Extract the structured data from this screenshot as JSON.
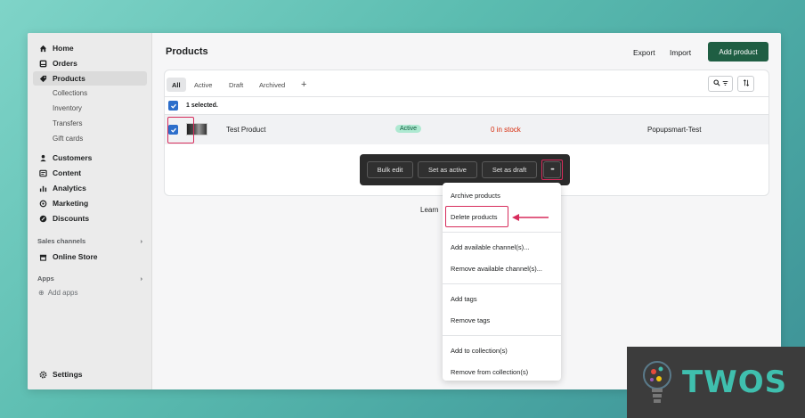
{
  "sidebar": {
    "items": [
      {
        "label": "Home",
        "icon": "home-icon"
      },
      {
        "label": "Orders",
        "icon": "orders-icon"
      },
      {
        "label": "Products",
        "icon": "tag-icon"
      }
    ],
    "sub_items": [
      "Collections",
      "Inventory",
      "Transfers",
      "Gift cards"
    ],
    "items2": [
      {
        "label": "Customers",
        "icon": "person-icon"
      },
      {
        "label": "Content",
        "icon": "content-icon"
      },
      {
        "label": "Analytics",
        "icon": "bar-chart-icon"
      },
      {
        "label": "Marketing",
        "icon": "target-icon"
      },
      {
        "label": "Discounts",
        "icon": "discount-icon"
      }
    ],
    "sales_channels": "Sales channels",
    "online_store": "Online Store",
    "apps": "Apps",
    "add_apps": "Add apps",
    "settings": "Settings"
  },
  "header": {
    "title": "Products",
    "export": "Export",
    "import": "Import",
    "add_product": "Add product"
  },
  "tabs": [
    "All",
    "Active",
    "Draft",
    "Archived",
    "+"
  ],
  "selection": {
    "label": "1 selected."
  },
  "product": {
    "name": "Test Product",
    "status": "Active",
    "inventory": "0 in stock",
    "vendor": "Popupsmart-Test"
  },
  "bulk_actions": {
    "bulk_edit": "Bulk edit",
    "set_active": "Set as active",
    "set_draft": "Set as draft",
    "more": "•••"
  },
  "menu": {
    "archive": "Archive products",
    "delete": "Delete products",
    "add_channels": "Add available channel(s)...",
    "remove_channels": "Remove available channel(s)...",
    "add_tags": "Add tags",
    "remove_tags": "Remove tags",
    "add_collection": "Add to collection(s)",
    "remove_collection": "Remove from collection(s)"
  },
  "learn_more": "Learn",
  "watermark": "TWOS",
  "colors": {
    "primary": "#1f5e43",
    "highlight": "#d72c5c",
    "checkbox": "#2c6ecb"
  }
}
